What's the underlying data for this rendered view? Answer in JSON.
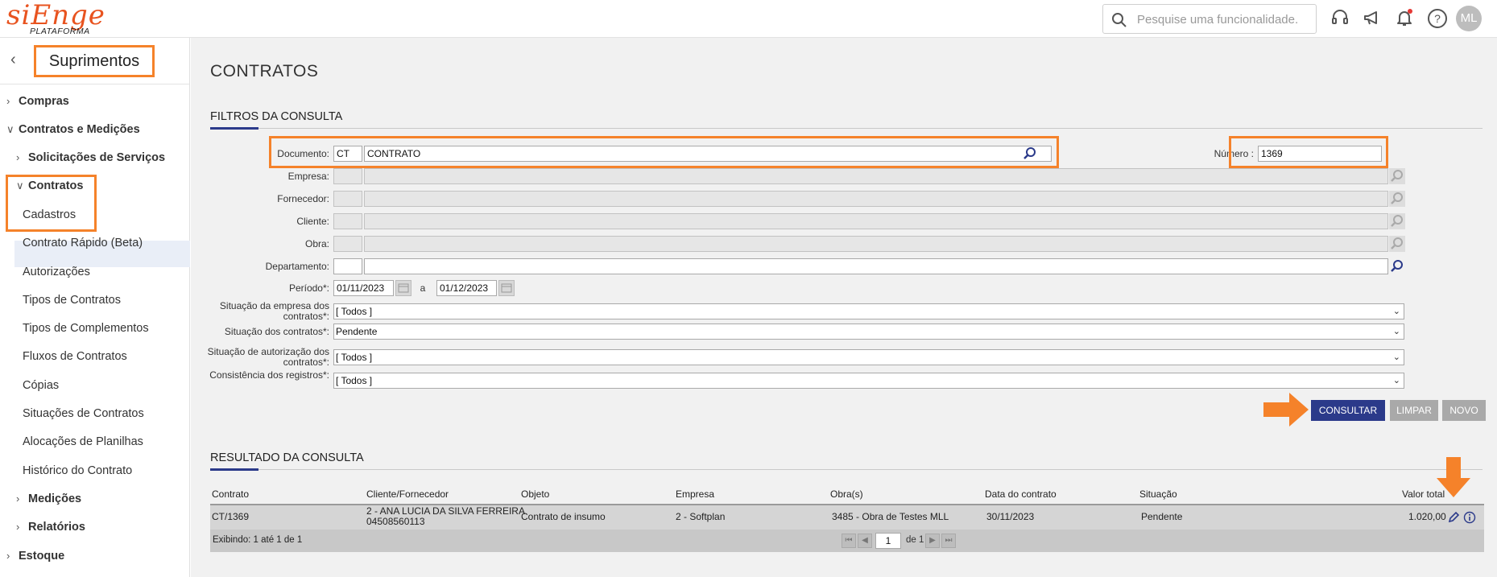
{
  "topbar": {
    "logo_word": "siEnge",
    "logo_sub": "PLATAFORMA",
    "search_placeholder": "Pesquise uma funcionalidade.",
    "avatar": "ML",
    "icons": [
      "search-icon",
      "headset-icon",
      "megaphone-icon",
      "bell-icon",
      "help-icon"
    ],
    "notification_dot_color": "#e53935"
  },
  "sidebar": {
    "module_title": "Suprimentos",
    "items": [
      {
        "label": "Compras"
      },
      {
        "label": "Contratos e Medições"
      },
      {
        "label": "Solicitações de Serviços"
      },
      {
        "label": "Contratos"
      },
      {
        "label": "Cadastros"
      },
      {
        "label": "Contrato Rápido (Beta)"
      },
      {
        "label": "Autorizações"
      },
      {
        "label": "Tipos de Contratos"
      },
      {
        "label": "Tipos de Complementos"
      },
      {
        "label": "Fluxos de Contratos"
      },
      {
        "label": "Cópias"
      },
      {
        "label": "Situações de Contratos"
      },
      {
        "label": "Alocações de Planilhas"
      },
      {
        "label": "Histórico do Contrato"
      },
      {
        "label": "Medições"
      },
      {
        "label": "Relatórios"
      },
      {
        "label": "Estoque"
      }
    ]
  },
  "page": {
    "title": "CONTRATOS",
    "filters_title": "FILTROS DA CONSULTA",
    "results_title": "RESULTADO DA CONSULTA"
  },
  "filters": {
    "documento_label": "Documento:",
    "documento_code": "CT",
    "documento_desc": "CONTRATO",
    "numero_label": "Número :",
    "numero_value": "1369",
    "empresa_label": "Empresa:",
    "fornecedor_label": "Fornecedor:",
    "cliente_label": "Cliente:",
    "obra_label": "Obra:",
    "departamento_label": "Departamento:",
    "periodo_label": "Período*:",
    "periodo_from": "01/11/2023",
    "periodo_sep": "a",
    "periodo_to": "01/12/2023",
    "sit_empresa_label": "Situação da empresa dos contratos*:",
    "sit_empresa_value": "[ Todos ]",
    "sit_contratos_label": "Situação dos contratos*:",
    "sit_contratos_value": "Pendente",
    "sit_autorizacao_label": "Situação de autorização dos contratos*:",
    "sit_autorizacao_value": "[ Todos ]",
    "consistencia_label": "Consistência dos registros*:",
    "consistencia_value": "[ Todos ]"
  },
  "buttons": {
    "consultar": "CONSULTAR",
    "limpar": "LIMPAR",
    "novo": "NOVO"
  },
  "colors": {
    "accent_orange": "#f5822a",
    "primary_button": "#2b3a8a",
    "disabled_button": "#a9a9a9"
  },
  "grid": {
    "columns": [
      "Contrato",
      "Cliente/Fornecedor",
      "Objeto",
      "Empresa",
      "Obra(s)",
      "Data do contrato",
      "Situação",
      "Valor total"
    ],
    "rows": [
      {
        "contrato": "CT/1369",
        "cliente_l1": "2 - ANA LUCIA DA SILVA FERREIRA",
        "cliente_l2": "04508560113",
        "objeto": "Contrato de insumo",
        "empresa": "2 - Softplan",
        "obras": "3485 - Obra de Testes MLL",
        "data": "30/11/2023",
        "situacao": "Pendente",
        "valor": "1.020,00"
      }
    ],
    "footer_prefix": "Exibindo:",
    "footer_text": "1 até 1 de 1",
    "page_value": "1",
    "page_of": "de 1"
  }
}
